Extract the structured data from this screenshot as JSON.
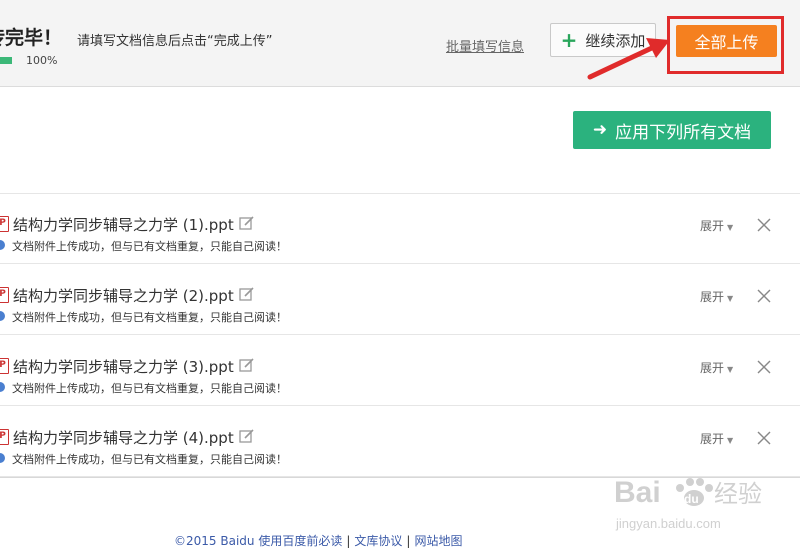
{
  "header": {
    "title": "传完毕！",
    "hint": "请填写文档信息后点击“完成上传”",
    "progress_percent": 100,
    "progress_text": "100%",
    "batch_link": "批量填写信息",
    "add_more_label": "继续添加",
    "upload_all_label": "全部上传"
  },
  "apply_all_label": "应用下列所有文档",
  "files": [
    {
      "name": "结构力学同步辅导之力学 (1).ppt",
      "status": "文档附件上传成功，但与已有文档重复，只能自己阅读！",
      "expand": "展开"
    },
    {
      "name": "结构力学同步辅导之力学 (2).ppt",
      "status": "文档附件上传成功，但与已有文档重复，只能自己阅读！",
      "expand": "展开"
    },
    {
      "name": "结构力学同步辅导之力学 (3).ppt",
      "status": "文档附件上传成功，但与已有文档重复，只能自己阅读！",
      "expand": "展开"
    },
    {
      "name": "结构力学同步辅导之力学 (4).ppt",
      "status": "文档附件上传成功，但与已有文档重复，只能自己阅读！",
      "expand": "展开"
    }
  ],
  "footer": {
    "copyright": "©2015 Baidu",
    "link1": "使用百度前必读",
    "link2": "文库协议",
    "link3": "网站地图"
  },
  "watermark": {
    "brand": "Bai",
    "brand2": "du",
    "product": "经验",
    "url": "jingyan.baidu.com"
  },
  "colors": {
    "accent_orange": "#f5801f",
    "accent_green": "#2bb27e",
    "highlight_red": "#e02b2b",
    "link_blue": "#3b5aa8"
  }
}
